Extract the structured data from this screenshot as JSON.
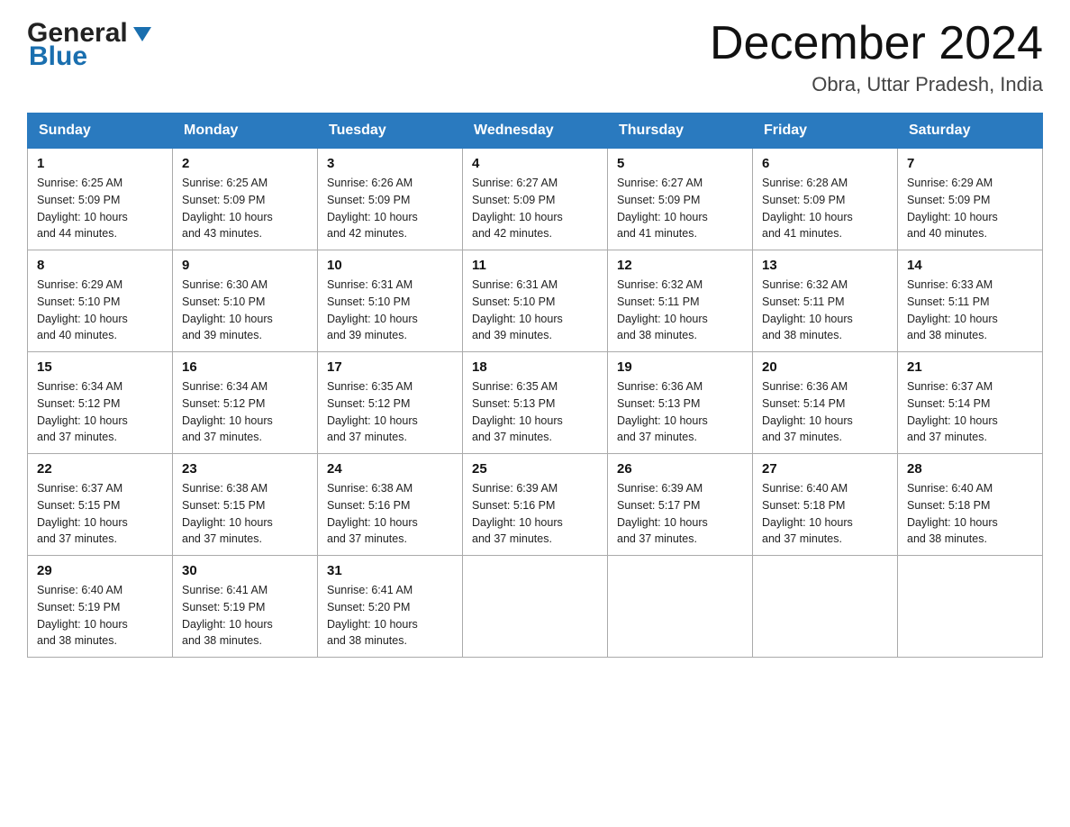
{
  "header": {
    "logo_text_general": "General",
    "logo_text_blue": "Blue",
    "month_year": "December 2024",
    "location": "Obra, Uttar Pradesh, India"
  },
  "days_of_week": [
    "Sunday",
    "Monday",
    "Tuesday",
    "Wednesday",
    "Thursday",
    "Friday",
    "Saturday"
  ],
  "weeks": [
    [
      {
        "day": "1",
        "sunrise": "6:25 AM",
        "sunset": "5:09 PM",
        "daylight": "10 hours and 44 minutes."
      },
      {
        "day": "2",
        "sunrise": "6:25 AM",
        "sunset": "5:09 PM",
        "daylight": "10 hours and 43 minutes."
      },
      {
        "day": "3",
        "sunrise": "6:26 AM",
        "sunset": "5:09 PM",
        "daylight": "10 hours and 42 minutes."
      },
      {
        "day": "4",
        "sunrise": "6:27 AM",
        "sunset": "5:09 PM",
        "daylight": "10 hours and 42 minutes."
      },
      {
        "day": "5",
        "sunrise": "6:27 AM",
        "sunset": "5:09 PM",
        "daylight": "10 hours and 41 minutes."
      },
      {
        "day": "6",
        "sunrise": "6:28 AM",
        "sunset": "5:09 PM",
        "daylight": "10 hours and 41 minutes."
      },
      {
        "day": "7",
        "sunrise": "6:29 AM",
        "sunset": "5:09 PM",
        "daylight": "10 hours and 40 minutes."
      }
    ],
    [
      {
        "day": "8",
        "sunrise": "6:29 AM",
        "sunset": "5:10 PM",
        "daylight": "10 hours and 40 minutes."
      },
      {
        "day": "9",
        "sunrise": "6:30 AM",
        "sunset": "5:10 PM",
        "daylight": "10 hours and 39 minutes."
      },
      {
        "day": "10",
        "sunrise": "6:31 AM",
        "sunset": "5:10 PM",
        "daylight": "10 hours and 39 minutes."
      },
      {
        "day": "11",
        "sunrise": "6:31 AM",
        "sunset": "5:10 PM",
        "daylight": "10 hours and 39 minutes."
      },
      {
        "day": "12",
        "sunrise": "6:32 AM",
        "sunset": "5:11 PM",
        "daylight": "10 hours and 38 minutes."
      },
      {
        "day": "13",
        "sunrise": "6:32 AM",
        "sunset": "5:11 PM",
        "daylight": "10 hours and 38 minutes."
      },
      {
        "day": "14",
        "sunrise": "6:33 AM",
        "sunset": "5:11 PM",
        "daylight": "10 hours and 38 minutes."
      }
    ],
    [
      {
        "day": "15",
        "sunrise": "6:34 AM",
        "sunset": "5:12 PM",
        "daylight": "10 hours and 37 minutes."
      },
      {
        "day": "16",
        "sunrise": "6:34 AM",
        "sunset": "5:12 PM",
        "daylight": "10 hours and 37 minutes."
      },
      {
        "day": "17",
        "sunrise": "6:35 AM",
        "sunset": "5:12 PM",
        "daylight": "10 hours and 37 minutes."
      },
      {
        "day": "18",
        "sunrise": "6:35 AM",
        "sunset": "5:13 PM",
        "daylight": "10 hours and 37 minutes."
      },
      {
        "day": "19",
        "sunrise": "6:36 AM",
        "sunset": "5:13 PM",
        "daylight": "10 hours and 37 minutes."
      },
      {
        "day": "20",
        "sunrise": "6:36 AM",
        "sunset": "5:14 PM",
        "daylight": "10 hours and 37 minutes."
      },
      {
        "day": "21",
        "sunrise": "6:37 AM",
        "sunset": "5:14 PM",
        "daylight": "10 hours and 37 minutes."
      }
    ],
    [
      {
        "day": "22",
        "sunrise": "6:37 AM",
        "sunset": "5:15 PM",
        "daylight": "10 hours and 37 minutes."
      },
      {
        "day": "23",
        "sunrise": "6:38 AM",
        "sunset": "5:15 PM",
        "daylight": "10 hours and 37 minutes."
      },
      {
        "day": "24",
        "sunrise": "6:38 AM",
        "sunset": "5:16 PM",
        "daylight": "10 hours and 37 minutes."
      },
      {
        "day": "25",
        "sunrise": "6:39 AM",
        "sunset": "5:16 PM",
        "daylight": "10 hours and 37 minutes."
      },
      {
        "day": "26",
        "sunrise": "6:39 AM",
        "sunset": "5:17 PM",
        "daylight": "10 hours and 37 minutes."
      },
      {
        "day": "27",
        "sunrise": "6:40 AM",
        "sunset": "5:18 PM",
        "daylight": "10 hours and 37 minutes."
      },
      {
        "day": "28",
        "sunrise": "6:40 AM",
        "sunset": "5:18 PM",
        "daylight": "10 hours and 38 minutes."
      }
    ],
    [
      {
        "day": "29",
        "sunrise": "6:40 AM",
        "sunset": "5:19 PM",
        "daylight": "10 hours and 38 minutes."
      },
      {
        "day": "30",
        "sunrise": "6:41 AM",
        "sunset": "5:19 PM",
        "daylight": "10 hours and 38 minutes."
      },
      {
        "day": "31",
        "sunrise": "6:41 AM",
        "sunset": "5:20 PM",
        "daylight": "10 hours and 38 minutes."
      },
      null,
      null,
      null,
      null
    ]
  ],
  "labels": {
    "sunrise": "Sunrise:",
    "sunset": "Sunset:",
    "daylight": "Daylight:"
  }
}
